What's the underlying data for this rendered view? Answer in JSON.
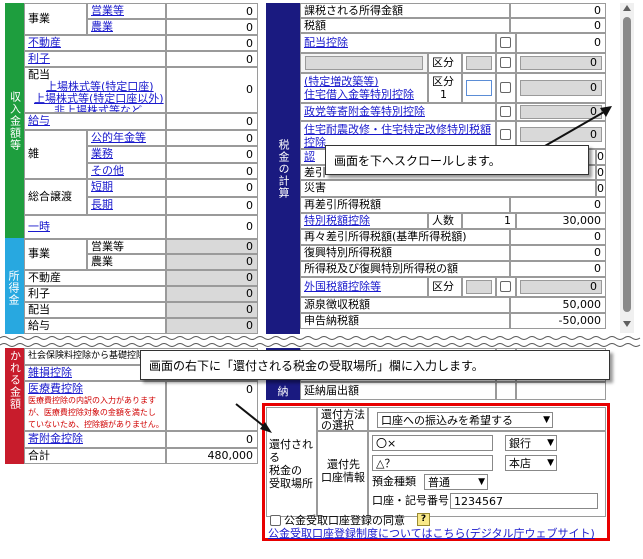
{
  "colors": {
    "green": "#1e9e3e",
    "blue": "#28a8e0",
    "navy": "#1a1a80",
    "red": "#c81c2c",
    "highlight": "#e80000",
    "link": "#1a1acc"
  },
  "left": {
    "income_section_label": "収入金額等",
    "shotoku_section_label": "所得金",
    "bottom_left_label": "かれる金額",
    "rows": {
      "jigyo": "事業",
      "eigyo": "営業等",
      "nogyo": "農業",
      "fudosan": "不動産",
      "rishi": "利子",
      "haito_title": "配当",
      "haito_line1": "上場株式等(特定口座)",
      "haito_line2": "上場株式等(特定口座以外)",
      "haito_line3": "非上場株式等など",
      "kyuyo": "給与",
      "zatsu": "雑",
      "koteki": "公的年金等",
      "gyomu": "業務",
      "sonota": "その他",
      "sogo": "総合譲渡",
      "tanki": "短期",
      "choki": "長期",
      "ichiji": "一時",
      "b_jigyo": "事業",
      "b_eigyo": "営業等",
      "b_nogyo": "農業",
      "b_fudosan": "不動産",
      "b_rishi": "利子",
      "b_haito": "配当",
      "b_kyuyo": "給与",
      "shakai": "社会保険料控除から基礎控除の",
      "zasson": "雑損控除",
      "iryo": "医療費控除",
      "iryo_note1": "医療費控除の内訳の入力があります",
      "iryo_note2": "が、医療費控除対象の金額を満たし",
      "iryo_note3": "ていないため、控除額がありません。",
      "kifu": "寄附金控除",
      "gokei": "合計"
    },
    "values": {
      "eigyo": "0",
      "nogyo": "0",
      "fudosan": "0",
      "rishi": "0",
      "haito": "0",
      "kyuyo": "0",
      "koteki": "0",
      "gyomu": "0",
      "sonota": "0",
      "tanki": "0",
      "choki": "0",
      "ichiji": "0",
      "b_eigyo": "0",
      "b_nogyo": "0",
      "b_fudosan": "0",
      "b_rishi": "0",
      "b_haito": "0",
      "b_kyuyo": "0",
      "zasson": "0",
      "iryo": "0",
      "kifu": "0",
      "gokei": "480,000"
    }
  },
  "right": {
    "section_label": "税金の計算",
    "rows": {
      "kazei": "課税される所得金額",
      "zeigaku": "税額",
      "haito_kojo": "配当控除",
      "kubun": "区分",
      "tokutei_line1": "(特定増改築等)",
      "tokutei_line2": "住宅借入金等特別控除",
      "kubun1_label": "区分",
      "kubun1_value": "1",
      "seito": "政党等寄附金等特別控除",
      "jutaku_line1": "住宅耐震改修・住宅特定改修特別税額",
      "jutaku_line2": "控除",
      "nintei_prefix": "認",
      "sashihiki_prefix": "差引",
      "saigai_prefix": "災害",
      "saisashihiki": "再差引所得税額",
      "tokubetsu": "特別税額控除",
      "ninzu": "人数",
      "ninzu_value": "1",
      "sasasashihiki": "再々差引所得税額(基準所得税額)",
      "fukko": "復興特別所得税額",
      "shotokuzei_fukko": "所得税及び復興特別所得税の額",
      "gaikoku": "外国税額控除等",
      "gensen": "源泉徴収税額",
      "shinkoku": "申告納税額",
      "nofu": "納",
      "enno": "延納届出額"
    },
    "values": {
      "kazei": "0",
      "zeigaku": "0",
      "haito_kojo": "0",
      "kubun_row": "0",
      "tokutei": "0",
      "seito": "0",
      "jutaku": "0",
      "nintei": "0",
      "sashihiki": "0",
      "saigai": "0",
      "saisashihiki": "0",
      "tokubetsu": "30,000",
      "sasasashihiki": "0",
      "fukko": "0",
      "shotokuzei_fukko": "0",
      "gaikoku": "0",
      "gensen": "50,000",
      "shinkoku": "-50,000"
    }
  },
  "refund": {
    "place_label_lines": [
      "還付される",
      "税金の",
      "受取場所"
    ],
    "method_label_lines": [
      "還付方法",
      "の選択"
    ],
    "method_value": "口座への振込みを希望する",
    "account_label_lines": [
      "還付先",
      "口座情報"
    ],
    "bank_name": "〇×",
    "bank_type": "銀行",
    "branch_name": "△？",
    "branch_type": "本店",
    "deposit_type_label": "預金種類",
    "deposit_type_value": "普通",
    "account_no_label": "口座・記号番号",
    "account_no_value": "1234567",
    "public_account_label": "公金受取口座登録の同意",
    "public_account_link": "公金受取口座登録制度についてはこちら(デジタル庁ウェブサイト)"
  },
  "callouts": {
    "scroll_down": "画面を下へスクロールします。",
    "input_refund": "画面の右下に「還付される税金の受取場所」欄に入力します。"
  }
}
